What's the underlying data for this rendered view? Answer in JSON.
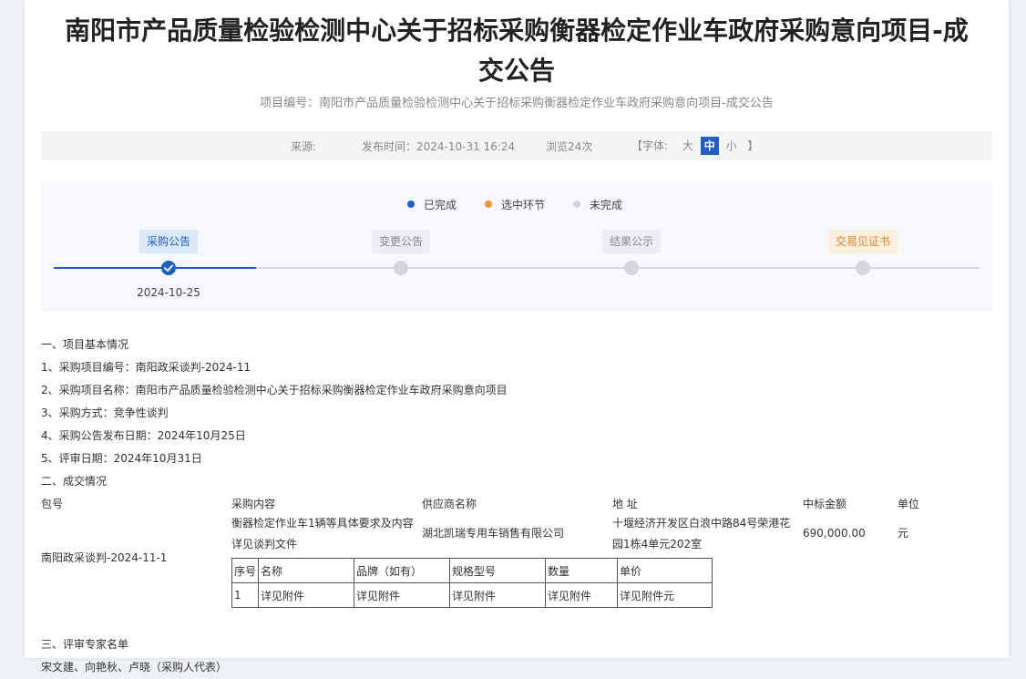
{
  "title": "南阳市产品质量检验检测中心关于招标采购衡器检定作业车政府采购意向项目-成交公告",
  "project_no": "项目编号：南阳市产品质量检验检测中心关于招标采购衡器检定作业车政府采购意向项目-成交公告",
  "meta": {
    "source": "来源:",
    "publish_time": "发布时间：2024-10-31 16:24",
    "views": "浏览24次",
    "font_open": "【字体:",
    "font_large": "大",
    "font_medium": "中",
    "font_small": "小",
    "font_close": "】"
  },
  "legend": [
    {
      "label": "已完成",
      "color": "#1f5fc3"
    },
    {
      "label": "选中环节",
      "color": "#f0922f"
    },
    {
      "label": "未完成",
      "color": "#d4d6da"
    }
  ],
  "steps": [
    {
      "label": "采购公告",
      "date": "2024-10-25",
      "state": "done"
    },
    {
      "label": "变更公告",
      "date": "",
      "state": "todo"
    },
    {
      "label": "结果公示",
      "date": "",
      "state": "todo"
    },
    {
      "label": "交易见证书",
      "date": "",
      "state": "special"
    }
  ],
  "sections": {
    "basic_heading": "一、项目基本情况",
    "basic_items": [
      "1、采购项目编号：南阳政采谈判-2024-11",
      "2、采购项目名称：南阳市产品质量检验检测中心关于招标采购衡器检定作业车政府采购意向项目",
      "3、采购方式：竞争性谈判",
      "4、采购公告发布日期：2024年10月25日",
      "5、评审日期：2024年10月31日"
    ],
    "deal_heading": "二、成交情况",
    "expert_heading": "三、评审专家名单",
    "experts": "宋文建、向艳秋、卢晓（采购人代表）"
  },
  "deal": {
    "headers": {
      "package": "包号",
      "content": "采购内容",
      "supplier": "供应商名称",
      "address": "地 址",
      "amount": "中标金额",
      "unit": "单位"
    },
    "package": "南阳政采谈判-2024-11-1",
    "content_line1": "衡器检定作业车1辆等具体要求及内容",
    "content_line2": "详见谈判文件",
    "supplier": "湖北凯瑞专用车销售有限公司",
    "address_line1": "十堰经济开发区白浪中路84号荣港花",
    "address_line2": "园1栋4单元202室",
    "amount": "690,000.00",
    "unit": "元",
    "items_table": {
      "headers": [
        "序号",
        "名称",
        "品牌（如有）",
        "规格型号",
        "数量",
        "单价"
      ],
      "rows": [
        [
          "1",
          "详见附件",
          "详见附件",
          "详见附件",
          "详见附件",
          "详见附件元"
        ]
      ]
    }
  }
}
